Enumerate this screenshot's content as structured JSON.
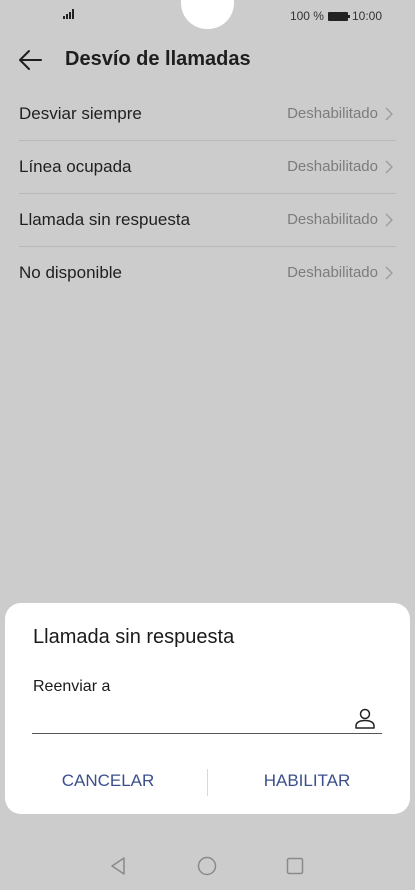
{
  "status_bar": {
    "battery_percent": "100 %",
    "time": "10:00"
  },
  "header": {
    "title": "Desvío de llamadas"
  },
  "list": {
    "items": [
      {
        "label": "Desviar siempre",
        "value": "Deshabilitado"
      },
      {
        "label": "Línea ocupada",
        "value": "Deshabilitado"
      },
      {
        "label": "Llamada sin respuesta",
        "value": "Deshabilitado"
      },
      {
        "label": "No disponible",
        "value": "Deshabilitado"
      }
    ]
  },
  "dialog": {
    "title": "Llamada sin respuesta",
    "field_label": "Reenviar a",
    "field_value": "",
    "cancel_label": "CANCELAR",
    "enable_label": "HABILITAR"
  },
  "colors": {
    "accent": "#3c4f8c",
    "background": "#cccccc",
    "dialog": "#ffffff"
  },
  "icons": {
    "back": "arrow-left-icon",
    "chevron": "chevron-right-icon",
    "contact": "person-icon",
    "nav_back": "triangle-back-icon",
    "nav_home": "circle-home-icon",
    "nav_recents": "square-recents-icon"
  }
}
